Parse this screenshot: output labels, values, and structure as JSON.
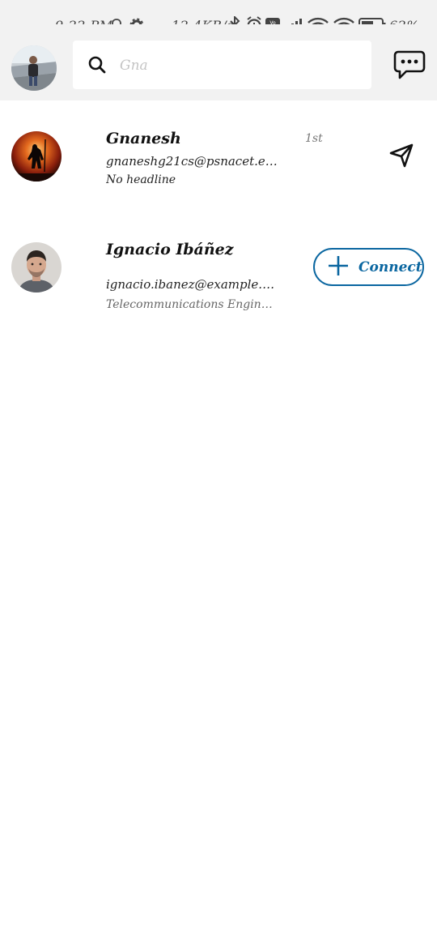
{
  "status_bar": {
    "time": "9:22 PM",
    "network_speed": "12.4KB/s",
    "battery": "62%",
    "icons": [
      "snapchat-icon",
      "settings-icon",
      "bluetooth-icon",
      "alarm-icon",
      "volte-icon",
      "signal-icon",
      "wifi-icon",
      "wifi-icon",
      "battery-icon"
    ]
  },
  "header": {
    "avatar_icon": "profile-photo",
    "search": {
      "value": "",
      "placeholder": "Gna"
    },
    "messages_icon": "messaging-icon"
  },
  "results": [
    {
      "name": "Gnanesh",
      "degree": "1st",
      "email": "gnaneshg21cs@psnacet.e…",
      "headline": "No headline",
      "action": "send-message-icon"
    },
    {
      "name": "Ignacio Ibáñez",
      "email": "ignacio.ibanez@example.…",
      "headline": "Telecommunications Engin…",
      "action_label": "Connect"
    }
  ],
  "colors": {
    "header_bg": "#f2f2f2",
    "accent": "#0a66a0"
  }
}
